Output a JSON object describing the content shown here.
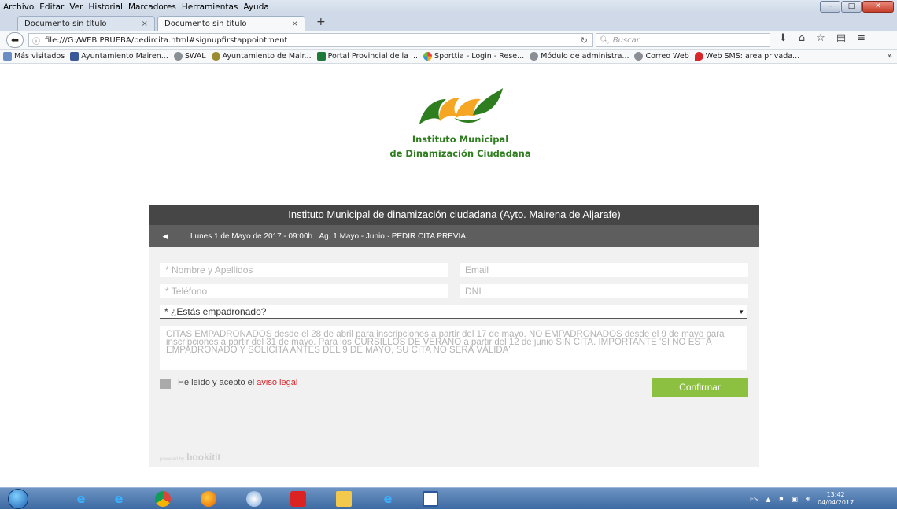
{
  "browser": {
    "menu": [
      "Archivo",
      "Editar",
      "Ver",
      "Historial",
      "Marcadores",
      "Herramientas",
      "Ayuda"
    ],
    "tabs": [
      {
        "label": "Documento sin título",
        "close": "×"
      },
      {
        "label": "Documento sin título",
        "close": "×"
      }
    ],
    "new_tab": "+",
    "url": "file:///G:/WEB PRUEBA/pedircita.html#signupfirstappointment",
    "search_placeholder": "Buscar",
    "bookmarks": [
      {
        "label": "Más visitados",
        "icon": "most-visited-icon"
      },
      {
        "label": "Ayuntamiento Mairen...",
        "icon": "facebook-icon"
      },
      {
        "label": "SWAL",
        "icon": "globe-icon"
      },
      {
        "label": "Ayuntamiento de Mair...",
        "icon": "seal-icon"
      },
      {
        "label": "Portal Provincial de la ...",
        "icon": "portal-icon"
      },
      {
        "label": "Sporttia - Login - Rese...",
        "icon": "sporttia-icon"
      },
      {
        "label": "Módulo de administra...",
        "icon": "globe-icon"
      },
      {
        "label": "Correo Web",
        "icon": "globe-icon"
      },
      {
        "label": "Web SMS: area privada...",
        "icon": "sms-icon"
      }
    ],
    "bookmarks_more": "»"
  },
  "page": {
    "logo": {
      "line1": "Instituto Municipal",
      "line2": "de Dinamización Ciudadana"
    },
    "widget": {
      "header": "Instituto Municipal de dinamización ciudadana (Ayto. Mairena de Aljarafe)",
      "back_glyph": "◀",
      "breadcrumb": "Lunes 1 de Mayo de 2017 - 09:00h · Ag. 1 Mayo - Junio · PEDIR CITA PREVIA",
      "fields": {
        "name_placeholder": "* Nombre y Apellidos",
        "email_placeholder": "Email",
        "phone_placeholder": "* Teléfono",
        "dni_placeholder": "DNI"
      },
      "select_value": "* ¿Estás empadronado?",
      "notes": "CITAS EMPADRONADOS desde el 28 de abril para inscripciones a partir del 17 de mayo. NO EMPADRONADOS desde el 9 de mayo para inscripciones a partir del 31 de mayo. Para los CURSILLOS DE VERANO a partir del 12 de junio SIN CITA. IMPORTANTE 'SI NO ESTÁ EMPADRONADO Y SOLICITA ANTES DEL 9 DE MAYO, SU CITA NO SERÁ VÁLIDA'",
      "accept_text": "He leído y acepto el",
      "accept_link": "aviso legal",
      "confirm_label": "Confirmar",
      "powered_small": "powered by",
      "powered_brand": "bookitit"
    }
  },
  "taskbar": {
    "language": "ES",
    "time": "13:42",
    "date": "04/04/2017"
  },
  "colors": {
    "logo_green": "#2e7d1e",
    "logo_orange": "#f5a623",
    "confirm_green": "#8cc040",
    "link_red": "#d9262b",
    "header_dark": "#464646"
  }
}
